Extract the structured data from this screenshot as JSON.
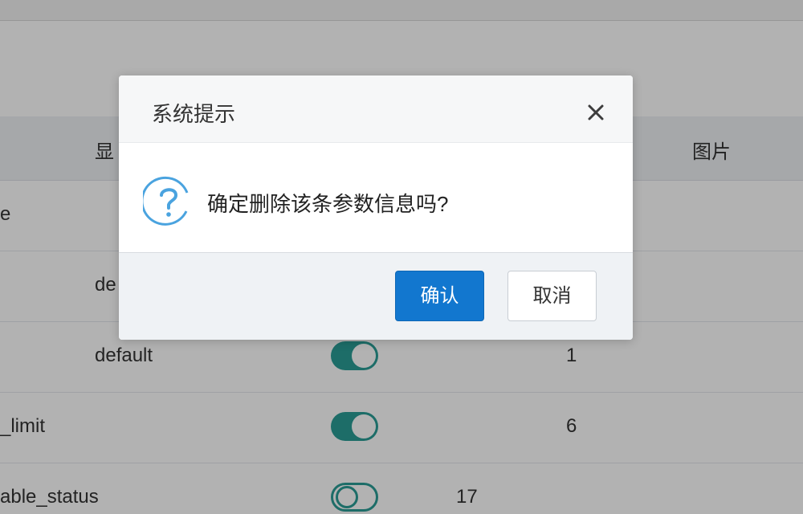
{
  "table": {
    "headers": {
      "display": "显",
      "image": "图片"
    },
    "rows": [
      {
        "name": "e",
        "display": "",
        "switch": null,
        "num": ""
      },
      {
        "name": "",
        "display": "de",
        "switch": null,
        "num": ""
      },
      {
        "name": "",
        "display": "default",
        "switch": "on",
        "num": "1"
      },
      {
        "name": "_limit",
        "display": "",
        "switch": "on",
        "num": "6"
      },
      {
        "name": "able_status",
        "display": "",
        "switch": "off",
        "num": "17"
      }
    ]
  },
  "dialog": {
    "title": "系统提示",
    "close_icon": "close-icon",
    "message_icon": "question-circle-icon",
    "message": "确定删除该条参数信息吗?",
    "confirm_label": "确认",
    "cancel_label": "取消"
  },
  "colors": {
    "primary": "#1277cf",
    "switch_on": "#2a9d95",
    "icon_blue": "#4aa3df"
  }
}
